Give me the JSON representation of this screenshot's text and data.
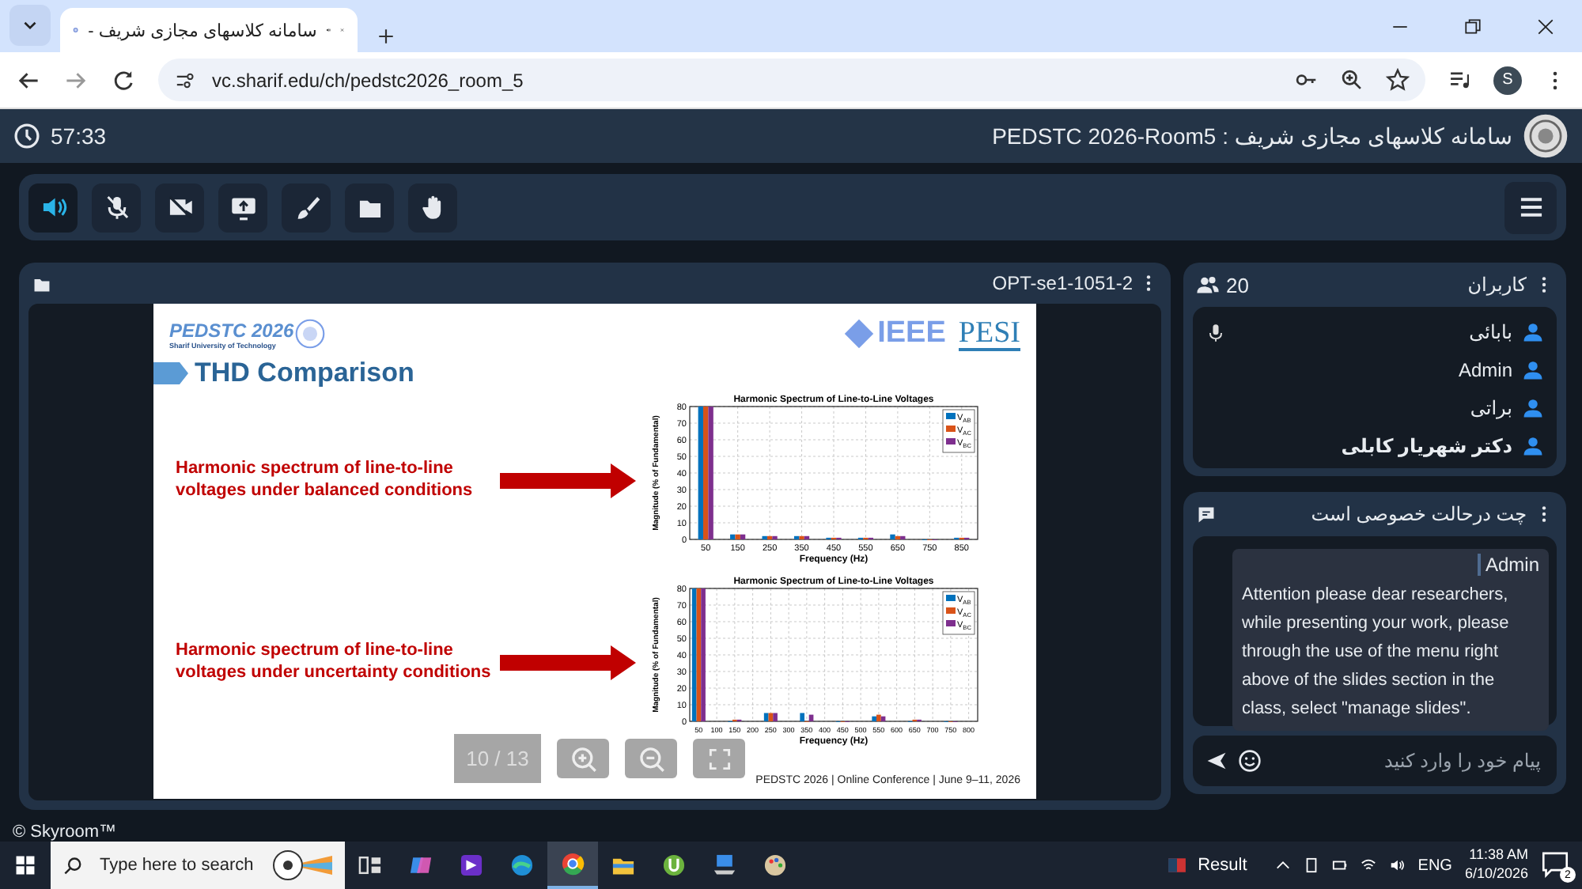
{
  "browser": {
    "tab_title": "سامانه کلاسهای مجازی شریف -",
    "url": "vc.sharif.edu/ch/pedstc2026_room_5",
    "profile_initial": "S"
  },
  "header": {
    "timer": "57:33",
    "title": "سامانه کلاسهای مجازی شریف : PEDSTC 2026-Room5"
  },
  "toolbar": [
    {
      "kind": "speaker",
      "selected": true
    },
    {
      "kind": "mic-off",
      "selected": false
    },
    {
      "kind": "camera-off",
      "selected": false
    },
    {
      "kind": "screen-share",
      "selected": false
    },
    {
      "kind": "brush",
      "selected": false
    },
    {
      "kind": "folder",
      "selected": false
    },
    {
      "kind": "hand",
      "selected": false
    }
  ],
  "presentation": {
    "file": "OPT-se1-1051-2",
    "page": "10 / 13",
    "slide": {
      "logo_title": "PEDSTC 2026",
      "logo_subtitle": "Sharif University of Technology",
      "ieee": "IEEE",
      "pesi": "PESI",
      "title": "THD Comparison",
      "footer": "PEDSTC 2026 | Online Conference | June 9–11, 2026",
      "rows": [
        {
          "text": "Harmonic spectrum of line-to-line voltages under balanced conditions",
          "chart_data": {
            "type": "bar",
            "title": "Harmonic Spectrum of Line-to-Line Voltages",
            "xlabel": "Frequency (Hz)",
            "ylabel": "Magnitude (% of Fundamental)",
            "categories": [
              "50",
              "150",
              "250",
              "350",
              "450",
              "550",
              "650",
              "750",
              "850"
            ],
            "ylim": [
              0,
              80
            ],
            "yticks": [
              0,
              10,
              20,
              30,
              40,
              50,
              60,
              70,
              80
            ],
            "grid": true,
            "legend": true,
            "series": [
              {
                "name": "V$_{AB}$",
                "color": "#0072bd",
                "values": [
                  80,
                  3,
                  2,
                  2,
                  1,
                  1,
                  3,
                  0,
                  1
                ]
              },
              {
                "name": "V$_{AC}$",
                "color": "#d95319",
                "values": [
                  80,
                  3,
                  2,
                  2,
                  1,
                  1,
                  2,
                  0,
                  1
                ]
              },
              {
                "name": "V$_{BC}$",
                "color": "#7e2f8e",
                "values": [
                  80,
                  3,
                  2,
                  2,
                  1,
                  1,
                  2,
                  0,
                  1
                ]
              }
            ]
          }
        },
        {
          "text": "Harmonic spectrum of line-to-line voltages under uncertainty conditions",
          "chart_data": {
            "type": "bar",
            "title": "Harmonic Spectrum of Line-to-Line Voltages",
            "xlabel": "Frequency (Hz)",
            "ylabel": "Magnitude (% of Fundamental)",
            "categories": [
              "50",
              "100",
              "150",
              "200",
              "250",
              "300",
              "350",
              "400",
              "450",
              "500",
              "550",
              "600",
              "650",
              "700",
              "750",
              "800"
            ],
            "ylim": [
              0,
              80
            ],
            "yticks": [
              0,
              10,
              20,
              30,
              40,
              50,
              60,
              70,
              80
            ],
            "grid": true,
            "legend": true,
            "series": [
              {
                "name": "V$_{AB}$",
                "color": "#0072bd",
                "values": [
                  80,
                  null,
                  0,
                  null,
                  5,
                  null,
                  5,
                  null,
                  0,
                  null,
                  3,
                  null,
                  0,
                  null,
                  0,
                  null
                ]
              },
              {
                "name": "V$_{AC}$",
                "color": "#d95319",
                "values": [
                  80,
                  null,
                  1,
                  null,
                  5,
                  null,
                  0,
                  null,
                  0,
                  null,
                  4,
                  null,
                  1,
                  null,
                  0,
                  null
                ]
              },
              {
                "name": "V$_{BC}$",
                "color": "#7e2f8e",
                "values": [
                  80,
                  null,
                  1,
                  null,
                  5,
                  null,
                  4,
                  null,
                  0,
                  null,
                  3,
                  null,
                  1,
                  null,
                  0,
                  null
                ]
              }
            ]
          }
        }
      ]
    }
  },
  "users": {
    "title": "کاربران",
    "count": "20",
    "list": [
      {
        "name": "بابائی",
        "mic": true,
        "presenter": false
      },
      {
        "name": "Admin",
        "mic": false,
        "presenter": false
      },
      {
        "name": "براتی",
        "mic": false,
        "presenter": false
      },
      {
        "name": "دکتر شهریار کابلی",
        "mic": false,
        "presenter": true
      }
    ]
  },
  "chat": {
    "title": "چت درحالت خصوصی است",
    "messages": [
      {
        "sender": "Admin",
        "text": "Attention please dear researchers, while presenting your work, please through the use of the menu right above of the slides section in the class, select \"manage slides\"."
      }
    ],
    "placeholder": "پیام خود را وارد کنید"
  },
  "footer": "© Skyroom™",
  "taskbar": {
    "search_placeholder": "Type here to search",
    "apps": [
      {
        "kind": "task-view",
        "selected": false
      },
      {
        "kind": "copilot",
        "selected": false
      },
      {
        "kind": "media",
        "selected": false
      },
      {
        "kind": "edge",
        "selected": false
      },
      {
        "kind": "chrome",
        "selected": true
      },
      {
        "kind": "explorer",
        "selected": false
      },
      {
        "kind": "torrent",
        "selected": false
      },
      {
        "kind": "network",
        "selected": false
      },
      {
        "kind": "paint",
        "selected": false
      }
    ],
    "news": "Result",
    "language": "ENG",
    "time": "11:38 AM",
    "date": "6/10/2026",
    "notifications": "2"
  }
}
